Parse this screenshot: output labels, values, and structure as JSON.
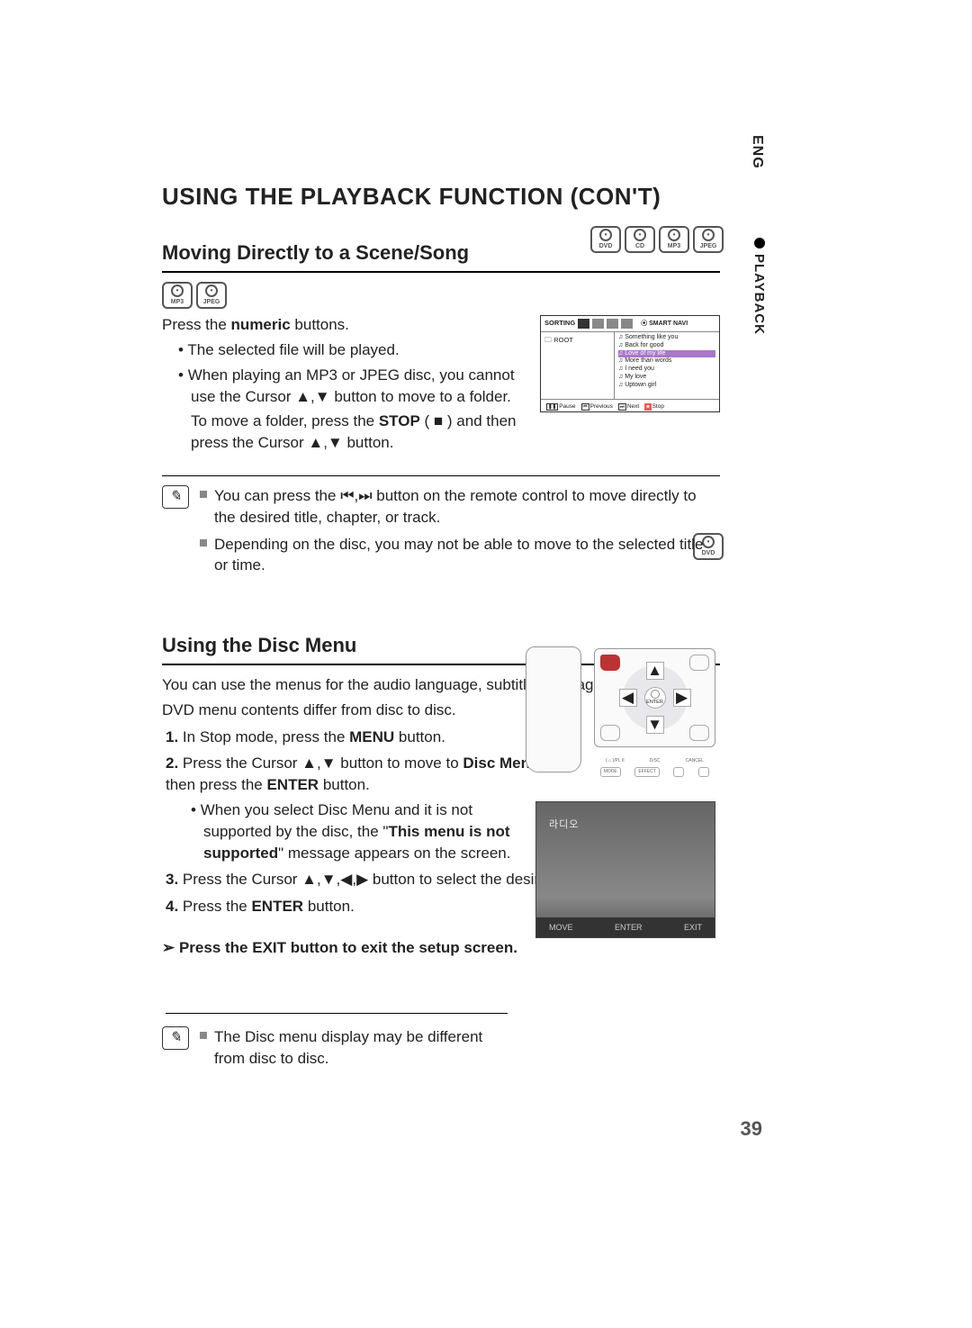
{
  "side": {
    "lang": "ENG",
    "section": "PLAYBACK",
    "page_number": "39"
  },
  "headings": {
    "main": "USING THE PLAYBACK FUNCTION (CON'T)",
    "scene": "Moving Directly to a Scene/Song",
    "discmenu": "Using the Disc Menu"
  },
  "badges": {
    "dvd": "DVD",
    "cd": "CD",
    "mp3": "MP3",
    "jpeg": "JPEG"
  },
  "scene": {
    "press_numeric_pre": "Press the ",
    "press_numeric_bold": "numeric",
    "press_numeric_post": " buttons.",
    "b1": "The selected ﬁle will be played.",
    "b2": "When playing an MP3 or JPEG disc, you cannot use the Cursor ▲,▼ button to move to a folder.",
    "b2b_pre": "To move a folder, press the ",
    "b2b_stop": "STOP",
    "b2b_mid": " ( ■ ) and then press the Cursor ▲,▼ button."
  },
  "scene_notes": {
    "n1_pre": "You can press the ",
    "n1_post": " button on the remote control to move directly to the desired title, chapter, or track.",
    "n2": "Depending on the disc, you may not be able to move to the selected title or time."
  },
  "smartnavi": {
    "sorting": "SORTING",
    "smart": "SMART NAVI",
    "root": "ROOT",
    "songs": [
      "Something like you",
      "Back for good",
      "Love of my life",
      "More than words",
      "I need you",
      "My love",
      "Uptown girl"
    ],
    "highlight_index": 2,
    "controls": {
      "pause": "Pause",
      "previous": "Previous",
      "next": "Next",
      "stop": "Stop"
    }
  },
  "discmenu": {
    "intro1": "You can use the menus for the audio language, subtitle language, proﬁle, etc.",
    "intro2": "DVD menu contents differ from disc to disc.",
    "s1_pre": "In Stop mode, press the ",
    "s1_bold": "MENU",
    "s1_post": " button.",
    "s2_pre": "Press the Cursor ▲,▼ button to move to ",
    "s2_target": "Disc Menu",
    "s2_mid": " and then press the ",
    "s2_enter": "ENTER",
    "s2_post": " button.",
    "s2b_pre": "When you select Disc Menu and it is not supported by the disc, the \"",
    "s2b_bold": "This menu is not supported",
    "s2b_post": "\" message appears on the screen.",
    "s3": "Press the Cursor ▲,▼,◀,▶ button to select the desired item.",
    "s4_pre": "Press the ",
    "s4_enter": "ENTER",
    "s4_post": " button.",
    "exit": "Press the EXIT button to exit the setup screen."
  },
  "pad": {
    "enter": "ENTER",
    "row": {
      "subpl2": "( ⌂ )/PL II",
      "dvsc": "D/SC",
      "cancel": "CANCEL",
      "mode": "MODE",
      "effect": "EFFECT"
    }
  },
  "tv": {
    "label": "라디오",
    "move": "MOVE",
    "enter": "ENTER",
    "exit": "EXIT"
  },
  "disc_note": "The Disc menu display may be different from disc to disc."
}
